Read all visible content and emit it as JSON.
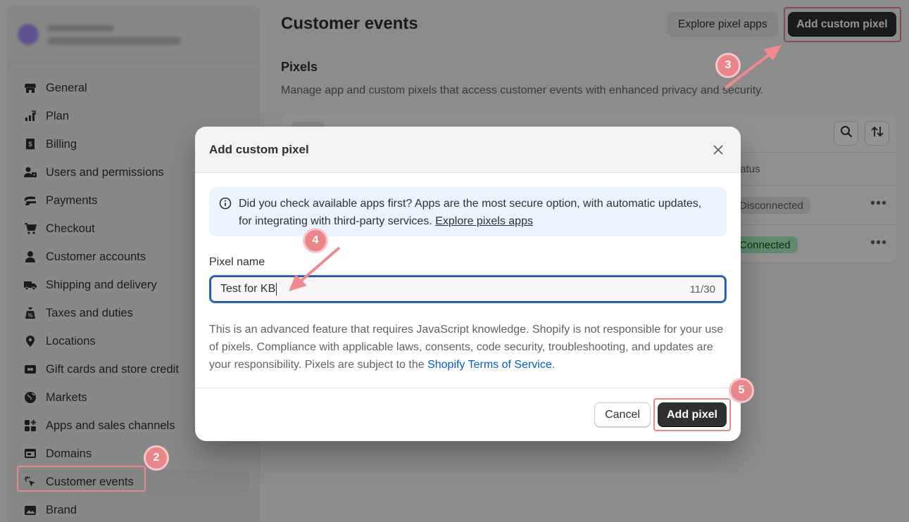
{
  "sidebar": {
    "items": [
      {
        "label": "General",
        "icon": "store-icon"
      },
      {
        "label": "Plan",
        "icon": "plan-icon"
      },
      {
        "label": "Billing",
        "icon": "billing-icon"
      },
      {
        "label": "Users and permissions",
        "icon": "users-icon"
      },
      {
        "label": "Payments",
        "icon": "payments-icon"
      },
      {
        "label": "Checkout",
        "icon": "cart-icon"
      },
      {
        "label": "Customer accounts",
        "icon": "person-icon"
      },
      {
        "label": "Shipping and delivery",
        "icon": "truck-icon"
      },
      {
        "label": "Taxes and duties",
        "icon": "tax-icon"
      },
      {
        "label": "Locations",
        "icon": "location-icon"
      },
      {
        "label": "Gift cards and store credit",
        "icon": "gift-card-icon"
      },
      {
        "label": "Markets",
        "icon": "globe-icon"
      },
      {
        "label": "Apps and sales channels",
        "icon": "apps-icon"
      },
      {
        "label": "Domains",
        "icon": "domain-icon"
      },
      {
        "label": "Customer events",
        "icon": "cursor-click-icon",
        "active": true
      },
      {
        "label": "Brand",
        "icon": "brand-icon"
      }
    ]
  },
  "page": {
    "title": "Customer events",
    "explore_btn": "Explore pixel apps",
    "add_custom_btn": "Add custom pixel",
    "section_title": "Pixels",
    "section_desc": "Manage app and custom pixels that access customer events with enhanced privacy and security.",
    "table": {
      "status_header": "tatus",
      "rows": [
        {
          "status": "Disconnected"
        },
        {
          "status": "Connected"
        }
      ]
    }
  },
  "modal": {
    "title": "Add custom pixel",
    "banner_text": "Did you check available apps first? Apps are the most secure option, with automatic updates, for integrating with third-party services.",
    "banner_link": "Explore pixels apps",
    "field_label": "Pixel name",
    "field_value": "Test for KB",
    "field_counter": "11/30",
    "disclaimer_text": "This is an advanced feature that requires JavaScript knowledge. Shopify is not responsible for your use of pixels. Compliance with applicable laws, consents, code security, troubleshooting, and updates are your responsibility. Pixels are subject to the",
    "disclaimer_link": "Shopify Terms of Service",
    "disclaimer_end": ".",
    "cancel_label": "Cancel",
    "add_label": "Add pixel"
  },
  "steps": {
    "s2": "2",
    "s3": "3",
    "s4": "4",
    "s5": "5"
  },
  "colors": {
    "accent": "#e8868a",
    "primary": "#303030",
    "link": "#005bd3",
    "connected_bg": "#a7f0ba",
    "disconnected_bg": "#e3e3e3"
  }
}
